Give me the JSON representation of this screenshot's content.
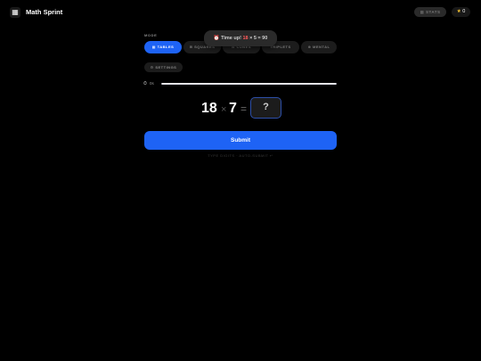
{
  "header": {
    "logo_icon": "▦",
    "title": "Math Sprint",
    "stats_label": "STATS",
    "stats_icon": "▦",
    "score_icon": "★",
    "score": "0"
  },
  "mode": {
    "label": "MODE",
    "tabs": [
      {
        "icon": "▦",
        "label": "TABLES",
        "active": true
      },
      {
        "icon": "⊞",
        "label": "SQUARES",
        "active": false
      },
      {
        "icon": "⊡",
        "label": "CUBES",
        "active": false
      },
      {
        "icon": "",
        "label": "TRIPLETS",
        "active": false
      },
      {
        "icon": "⊛",
        "label": "MENTAL",
        "active": false
      }
    ]
  },
  "toast": {
    "icon": "⏰",
    "prefix": "Time up! ",
    "highlight": "18",
    "suffix": " × 5 = 90"
  },
  "settings": {
    "icon": "⚙",
    "label": "SETTINGS"
  },
  "timer": {
    "icon": "⏱",
    "value": "0s",
    "progress": 1.0
  },
  "problem": {
    "a": "18",
    "operator": "×",
    "b": "7",
    "equals": "=",
    "answer_placeholder": "?"
  },
  "submit_label": "Submit",
  "hint": "TYPE DIGITS · AUTO-SUBMIT ↵",
  "colors": {
    "accent": "#1e63f5",
    "background": "#000000",
    "star": "#f7c531",
    "toast_highlight": "#ff5a5a"
  }
}
